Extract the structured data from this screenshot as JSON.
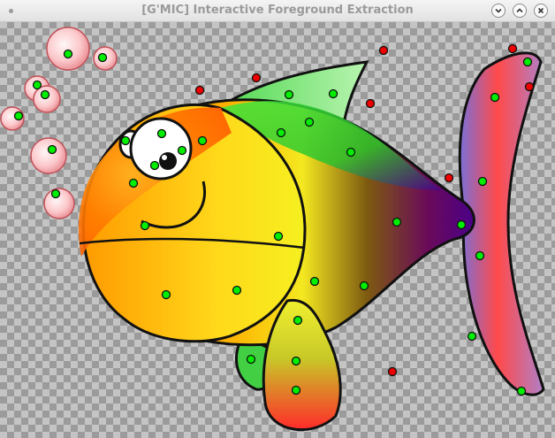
{
  "window": {
    "title": "[G'MIC] Interactive Foreground Extraction",
    "controls": [
      "minimize-icon",
      "maximize-icon",
      "close-icon"
    ]
  },
  "canvas": {
    "background": "checkerboard",
    "foreground_marker_color": "#00ee00",
    "background_marker_color": "#ee0000",
    "foreground_marker_count": 42,
    "background_marker_count": 9
  },
  "colors": {
    "fish_orange": "#ff7a00",
    "fish_yellow": "#ffee22",
    "fish_green": "#2fd32f",
    "fish_purple": "#5a0080",
    "tail_blue": "#7a70d8",
    "tail_red": "#ff3333",
    "bubble_pink": "#f6b0b4"
  }
}
